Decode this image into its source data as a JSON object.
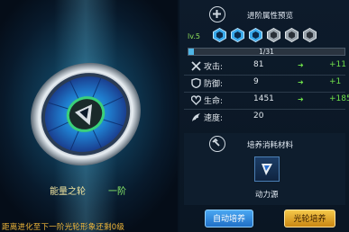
{
  "preview": {
    "wheel_name": "能量之轮",
    "tier": "一阶",
    "hint": "距离进化至下一阶光轮形象还剩0级"
  },
  "attributes": {
    "title": "进阶属性预览",
    "level": "lv.5",
    "stars_total": 6,
    "stars_lit": 3,
    "progress_text": "1/31",
    "progress_fraction": 0.032,
    "rows": [
      {
        "label": "攻击:",
        "value": "81",
        "increase": "+11",
        "icon": "sword-icon"
      },
      {
        "label": "防御:",
        "value": "9",
        "increase": "+1",
        "icon": "shield-icon"
      },
      {
        "label": "生命:",
        "value": "1451",
        "increase": "+185",
        "icon": "heart-icon"
      },
      {
        "label": "速度:",
        "value": "20",
        "increase": "",
        "icon": "wing-icon"
      }
    ]
  },
  "materials": {
    "title": "培养消耗材料",
    "item_name": "动力源",
    "icon": "hammer-icon"
  },
  "buttons": {
    "auto": "自动培养",
    "wheel": "光轮培养"
  },
  "colors": {
    "increase": "#6fe04a",
    "level": "#8ee05a",
    "hint": "#f0b73a",
    "button_blue": "#2a86d8",
    "button_gold": "#e0a52a"
  }
}
